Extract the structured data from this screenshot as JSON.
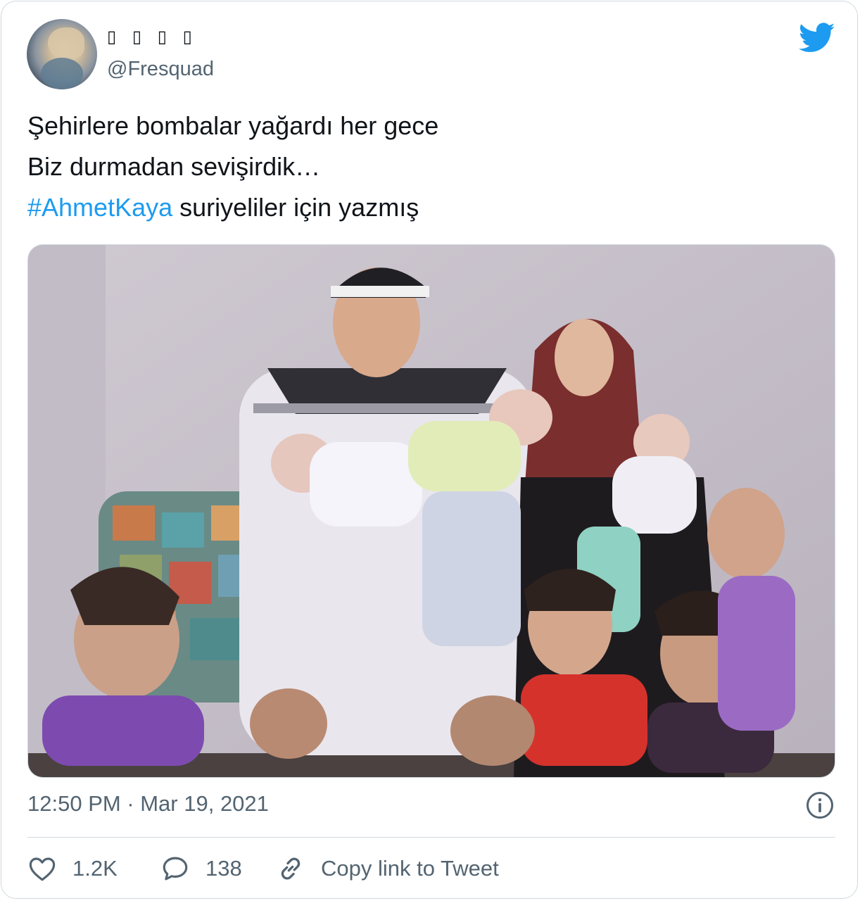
{
  "tweet": {
    "display_name": "▯ ▯ ▯ ▯",
    "handle": "@Fresquad",
    "text_lines": [
      "Şehirlere bombalar yağardı her gece",
      "Biz durmadan sevişirdik…"
    ],
    "hashtag": "#AhmetKaya",
    "hashtag_rest": " suriyeliler için yazmış",
    "timestamp": "12:50 PM · Mar 19, 2021",
    "likes": "1.2K",
    "replies": "138",
    "copy_link_label": "Copy link to Tweet"
  },
  "colors": {
    "accent": "#1d9bf0",
    "text": "#0f1419",
    "secondary": "#536471",
    "border": "#cfd9de"
  },
  "icons": {
    "brand": "twitter-bird-icon",
    "info": "info-icon",
    "like": "heart-icon",
    "reply": "speech-bubble-icon",
    "copy": "link-icon"
  }
}
